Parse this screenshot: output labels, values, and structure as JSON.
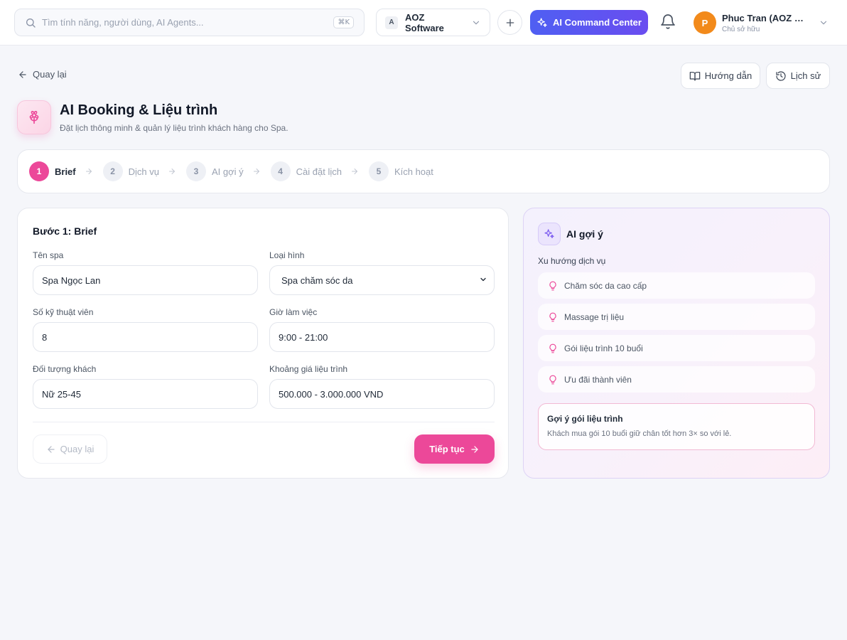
{
  "topbar": {
    "search_placeholder": "Tìm tính năng, người dùng, AI Agents...",
    "search_shortcut": "⌘K",
    "org_badge": "A",
    "org_name": "AOZ Software",
    "ai_command_label": "AI Command Center",
    "user_initial": "P",
    "user_name": "Phuc Tran (AOZ Software)",
    "user_role": "Chủ sở hữu"
  },
  "header": {
    "back_label": "Quay lại",
    "guide_label": "Hướng dẫn",
    "history_label": "Lịch sử",
    "title": "AI Booking & Liệu trình",
    "subtitle": "Đặt lịch thông minh & quản lý liệu trình khách hàng cho Spa."
  },
  "steps": [
    {
      "num": "1",
      "label": "Brief"
    },
    {
      "num": "2",
      "label": "Dịch vụ"
    },
    {
      "num": "3",
      "label": "AI gợi ý"
    },
    {
      "num": "4",
      "label": "Cài đặt lịch"
    },
    {
      "num": "5",
      "label": "Kích hoạt"
    }
  ],
  "form": {
    "title": "Bước 1: Brief",
    "spa_name_label": "Tên spa",
    "spa_name_value": "Spa Ngọc Lan",
    "type_label": "Loại hình",
    "type_value": "Spa chăm sóc da",
    "technicians_label": "Số kỹ thuật viên",
    "technicians_value": "8",
    "hours_label": "Giờ làm việc",
    "hours_value": "9:00 - 21:00",
    "audience_label": "Đối tượng khách",
    "audience_value": "Nữ 25-45",
    "price_label": "Khoảng giá liệu trình",
    "price_value": "500.000 - 3.000.000 VND",
    "prev_label": "Quay lại",
    "next_label": "Tiếp tục"
  },
  "ai_panel": {
    "title": "AI gợi ý",
    "trends_heading": "Xu hướng dịch vụ",
    "trends": [
      "Chăm sóc da cao cấp",
      "Massage trị liệu",
      "Gói liệu trình 10 buổi",
      "Ưu đãi thành viên"
    ],
    "suggest_title": "Gợi ý gói liệu trình",
    "suggest_text": "Khách mua gói 10 buổi giữ chân tốt hơn 3× so với lẻ."
  },
  "colors": {
    "accent": "#ec4899",
    "ai_gradient_start": "#4f5ff2",
    "ai_gradient_end": "#6a4df0",
    "avatar": "#f28a1b"
  }
}
